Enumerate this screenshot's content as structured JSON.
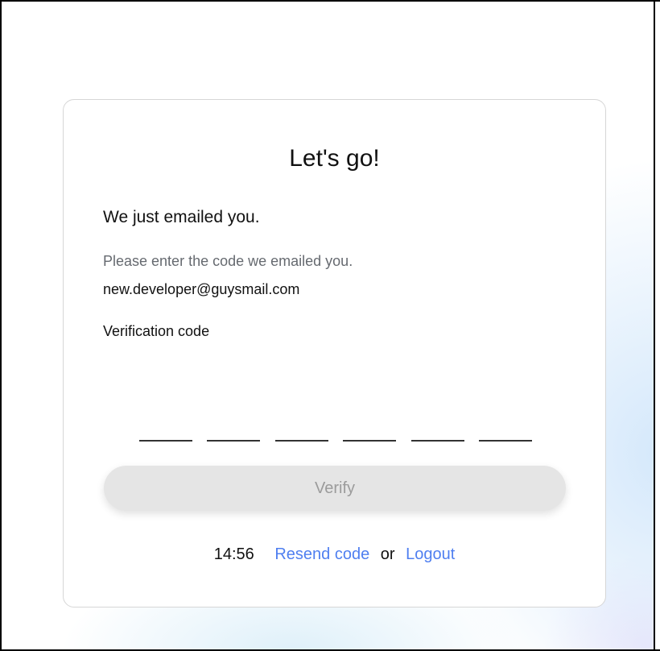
{
  "card": {
    "title": "Let's go!",
    "subtitle": "We just emailed you.",
    "instruction": "Please enter the code we emailed you.",
    "email": "new.developer@guysmail.com",
    "code_label": "Verification code",
    "code_digits": [
      "",
      "",
      "",
      "",
      "",
      ""
    ],
    "verify_label": "Verify",
    "timer": "14:56",
    "resend_label": "Resend code",
    "or_label": "or",
    "logout_label": "Logout"
  },
  "colors": {
    "link": "#4f7ff0",
    "button_bg": "#e5e5e5",
    "button_text": "#9b9b9b"
  }
}
